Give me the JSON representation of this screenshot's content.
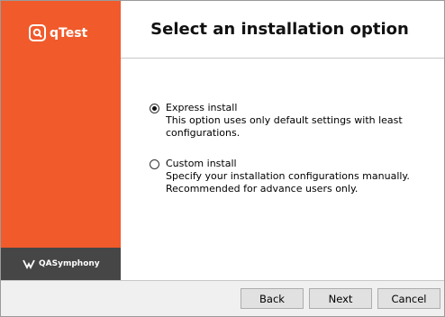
{
  "sidebar": {
    "logo_text": "qTest",
    "brand_text": "QASymphony",
    "accent_color": "#f15a2b",
    "strip_color": "#464646"
  },
  "header": {
    "title": "Select an installation option"
  },
  "options": [
    {
      "label": "Express install",
      "description": "This option uses only default settings with least configurations.",
      "selected": true
    },
    {
      "label": "Custom install",
      "description": "Specify your installation configurations manually. Recommended for advance users only.",
      "selected": false
    }
  ],
  "footer": {
    "back_label": "Back",
    "next_label": "Next",
    "cancel_label": "Cancel"
  }
}
